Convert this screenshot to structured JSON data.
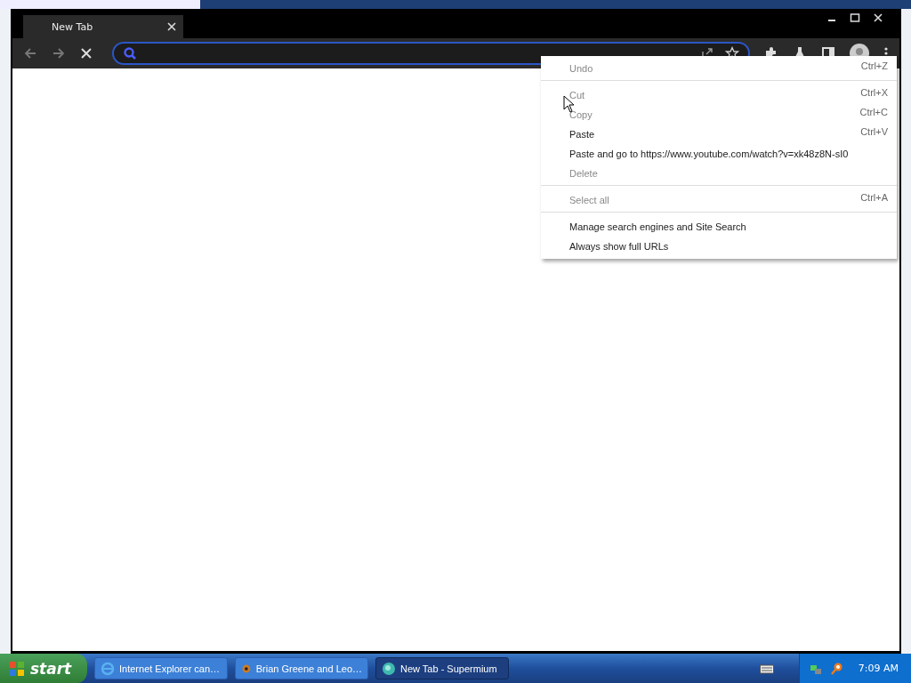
{
  "window": {
    "tabs": [
      {
        "label": "New Tab",
        "selected": true
      }
    ]
  },
  "context_menu": {
    "groups": [
      [
        {
          "label": "Undo",
          "shortcut": "Ctrl+Z",
          "disabled": true
        }
      ],
      [
        {
          "label": "Cut",
          "shortcut": "Ctrl+X",
          "disabled": true
        },
        {
          "label": "Copy",
          "shortcut": "Ctrl+C",
          "disabled": true
        },
        {
          "label": "Paste",
          "shortcut": "Ctrl+V",
          "disabled": false
        },
        {
          "label": "Paste and go to https://www.youtube.com/watch?v=xk48z8N-sI0",
          "disabled": false
        },
        {
          "label": "Delete",
          "disabled": true
        }
      ],
      [
        {
          "label": "Select all",
          "shortcut": "Ctrl+A",
          "disabled": true
        }
      ],
      [
        {
          "label": "Manage search engines and Site Search",
          "disabled": false
        },
        {
          "label": "Always show full URLs",
          "disabled": false
        }
      ]
    ]
  },
  "taskbar": {
    "start": "start",
    "tasks": [
      {
        "label": "Internet Explorer can…",
        "kind": "ie",
        "selected": false
      },
      {
        "label": "Brian Greene and Leo…",
        "kind": "media",
        "selected": false
      },
      {
        "label": "New Tab - Supermium",
        "kind": "browser",
        "selected": true
      }
    ],
    "clock": "7:09 AM"
  }
}
